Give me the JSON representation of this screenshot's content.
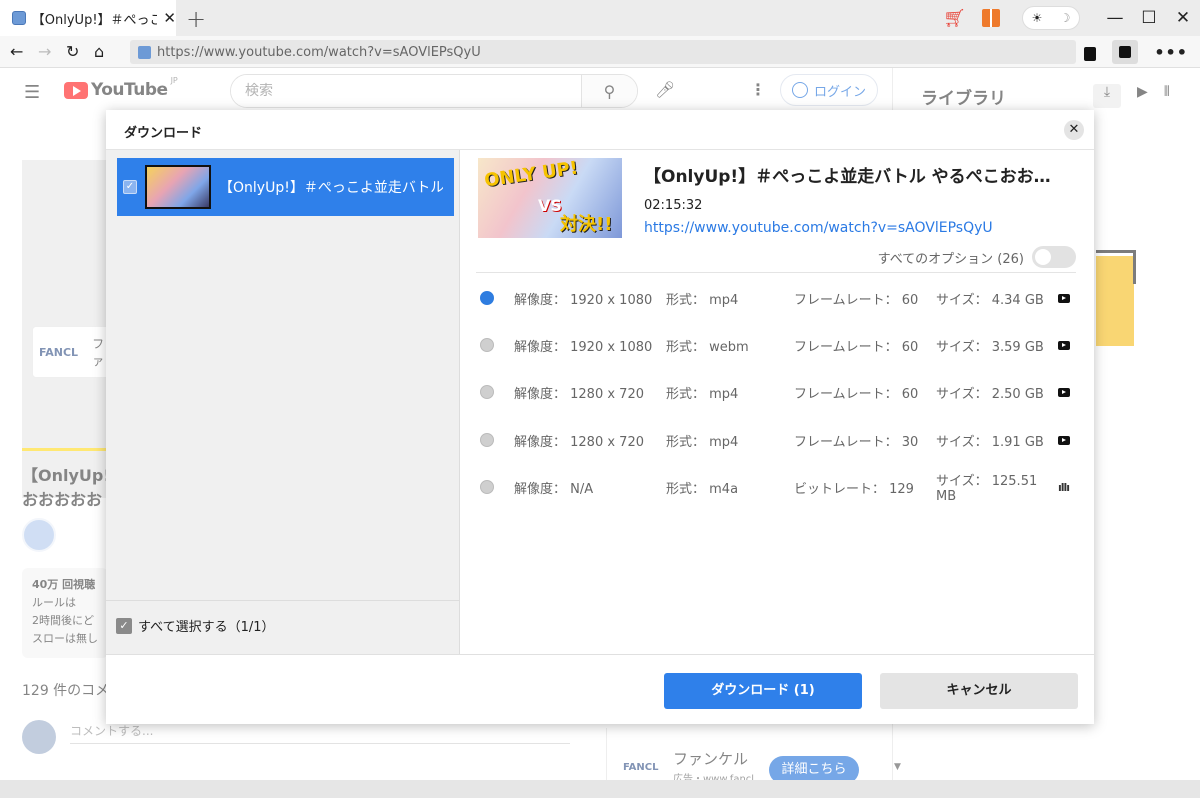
{
  "browser": {
    "tab_title": "【OnlyUp!】＃ぺっこよ並",
    "url": "https://www.youtube.com/watch?v=sAOVlEPsQyU",
    "new_tab_icon": "plus-icon",
    "theme_icons": [
      "sun-icon",
      "moon-icon"
    ]
  },
  "youtube": {
    "logo_text": "YouTube",
    "region": "JP",
    "search_placeholder": "検索",
    "login_label": "ログイン",
    "ad_card_brand": "FANCL",
    "ad_card_text": "ファ",
    "video_title": "【OnlyUp!】\nおおおおお",
    "description_lines": [
      "40万 回視聴",
      "ルールは",
      "2時間後にど",
      "スローは無し"
    ],
    "comments_count": "129 件のコメ",
    "comment_placeholder": "コメントする...",
    "ad": {
      "logo": "FANCL",
      "name": "ファンケル",
      "sub": "広告・www.fancl",
      "button": "詳細こちら"
    }
  },
  "library": {
    "title": "ライブラリ",
    "icons": [
      "download-icon",
      "youtube-icon",
      "audio-icon"
    ]
  },
  "dialog": {
    "title": "ダウンロード",
    "queue": [
      {
        "title": "【OnlyUp!】＃ぺっこよ並走バトル や…",
        "checked": true
      }
    ],
    "select_all_label": "すべて選択する（1/1）",
    "video": {
      "title": "【OnlyUp!】＃ぺっこよ並走バトル やるぺこおお…",
      "duration": "02:15:32",
      "url": "https://www.youtube.com/watch?v=sAOVlEPsQyU",
      "thumb_text_1": "ONLY UP!",
      "thumb_text_2": "VS",
      "thumb_text_3": "対決!!"
    },
    "all_options_label": "すべてのオプション (26)",
    "options": [
      {
        "selected": true,
        "res": "解像度： 1920 x 1080",
        "fmt": "形式： mp4",
        "rate": "フレームレート： 60",
        "size": "サイズ： 4.34 GB",
        "icon": "youtube-icon"
      },
      {
        "selected": false,
        "res": "解像度： 1920 x 1080",
        "fmt": "形式： webm",
        "rate": "フレームレート： 60",
        "size": "サイズ： 3.59 GB",
        "icon": "youtube-icon"
      },
      {
        "selected": false,
        "res": "解像度： 1280 x 720",
        "fmt": "形式： mp4",
        "rate": "フレームレート： 60",
        "size": "サイズ： 2.50 GB",
        "icon": "youtube-icon"
      },
      {
        "selected": false,
        "res": "解像度： 1280 x 720",
        "fmt": "形式： mp4",
        "rate": "フレームレート： 30",
        "size": "サイズ： 1.91 GB",
        "icon": "youtube-icon"
      },
      {
        "selected": false,
        "res": "解像度： N/A",
        "fmt": "形式： m4a",
        "rate": "ビットレート： 129",
        "size": "サイズ： 125.51 MB",
        "icon": "audio-icon"
      }
    ],
    "download_button": "ダウンロード (1)",
    "cancel_button": "キャンセル"
  }
}
